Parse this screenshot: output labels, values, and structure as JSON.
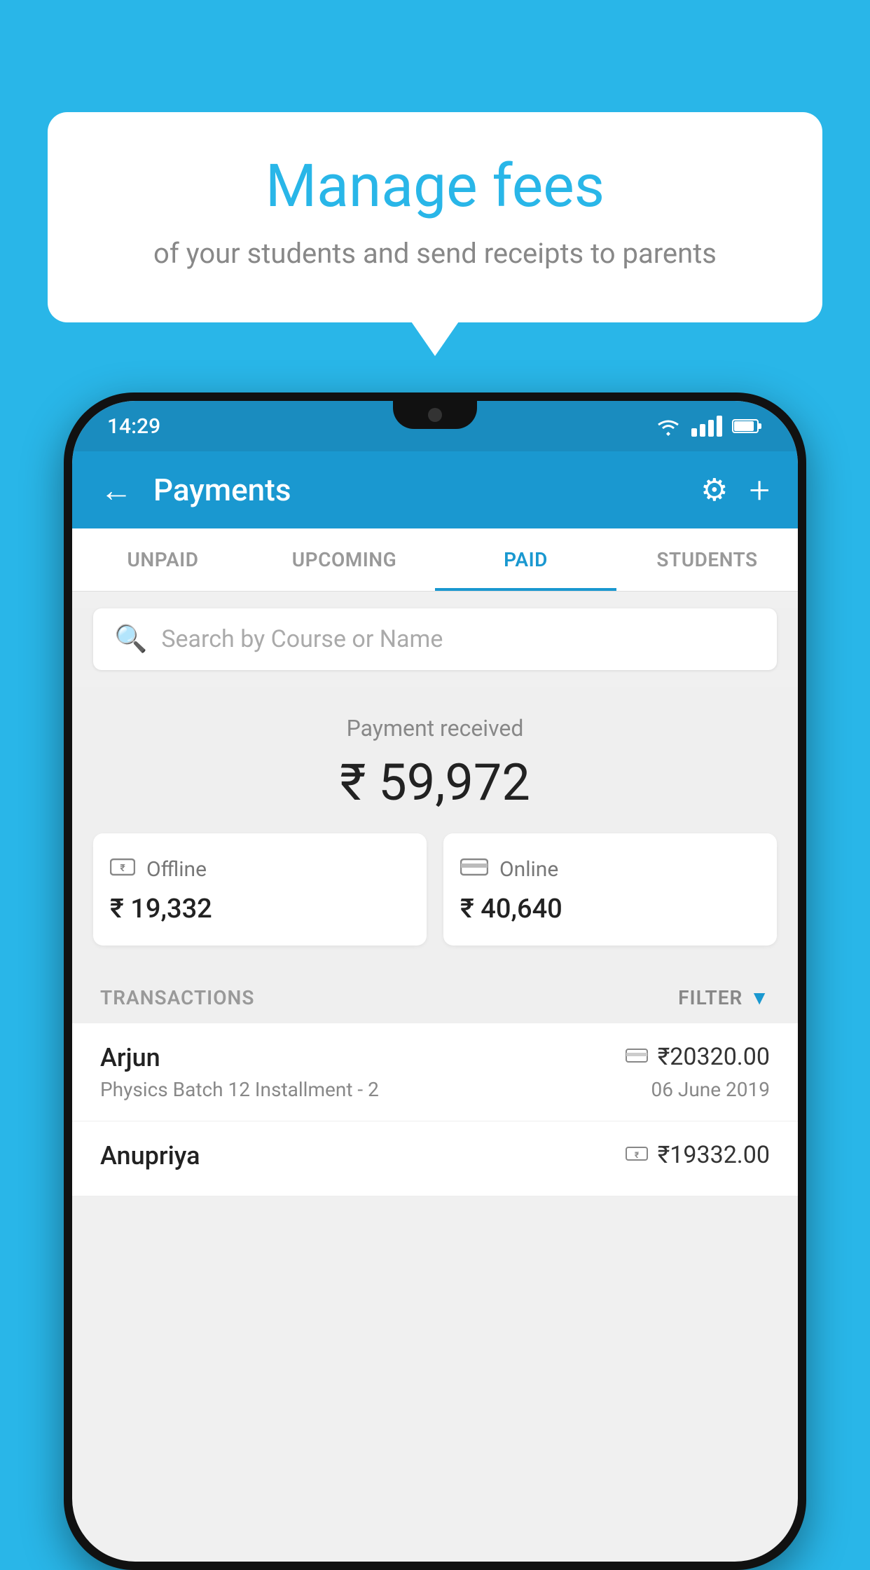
{
  "page": {
    "background_color": "#29b6e8"
  },
  "bubble": {
    "title": "Manage fees",
    "subtitle": "of your students and send receipts to parents"
  },
  "status_bar": {
    "time": "14:29"
  },
  "app_bar": {
    "title": "Payments",
    "back_icon": "←",
    "gear_icon": "⚙",
    "add_icon": "+"
  },
  "tabs": [
    {
      "label": "UNPAID",
      "active": false
    },
    {
      "label": "UPCOMING",
      "active": false
    },
    {
      "label": "PAID",
      "active": true
    },
    {
      "label": "STUDENTS",
      "active": false
    }
  ],
  "search": {
    "placeholder": "Search by Course or Name"
  },
  "payment_summary": {
    "label": "Payment received",
    "amount": "₹ 59,972",
    "offline": {
      "label": "Offline",
      "amount": "₹ 19,332"
    },
    "online": {
      "label": "Online",
      "amount": "₹ 40,640"
    }
  },
  "transactions": {
    "header_label": "TRANSACTIONS",
    "filter_label": "FILTER",
    "items": [
      {
        "name": "Arjun",
        "course": "Physics Batch 12 Installment - 2",
        "amount": "₹20320.00",
        "date": "06 June 2019",
        "payment_type": "online"
      },
      {
        "name": "Anupriya",
        "course": "",
        "amount": "₹19332.00",
        "date": "",
        "payment_type": "offline"
      }
    ]
  }
}
